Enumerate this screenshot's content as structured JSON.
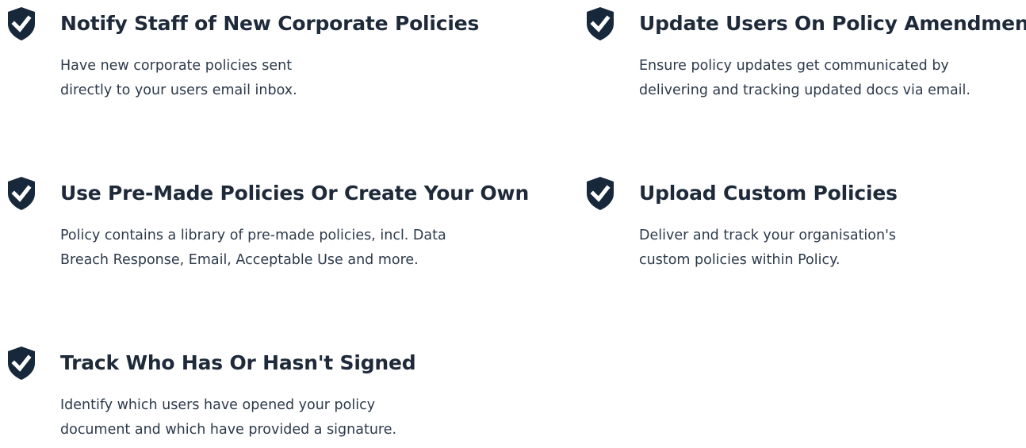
{
  "features": [
    {
      "icon": "shield-check-icon",
      "title": "Notify Staff of New Corporate Policies",
      "description": "Have new corporate policies sent\ndirectly to your users email inbox."
    },
    {
      "icon": "shield-check-icon",
      "title": "Update Users On Policy Amendments",
      "description": "Ensure policy updates get communicated by\ndelivering and tracking updated docs via email."
    },
    {
      "icon": "shield-check-icon",
      "title": "Use Pre-Made Policies Or Create Your Own",
      "description": "Policy contains a library of pre-made policies, incl. Data\nBreach Response, Email, Acceptable Use and more."
    },
    {
      "icon": "shield-check-icon",
      "title": "Upload Custom Policies",
      "description": "Deliver and track your organisation's\ncustom policies within Policy."
    },
    {
      "icon": "shield-check-icon",
      "title": "Track Who Has Or Hasn't Signed",
      "description": "Identify which users have opened your policy\ndocument and which have provided a signature."
    }
  ],
  "colors": {
    "icon_fill": "#17283a",
    "icon_check": "#ffffff",
    "title": "#1e2a3a",
    "text": "#2c3a4b",
    "background": "#ffffff"
  }
}
